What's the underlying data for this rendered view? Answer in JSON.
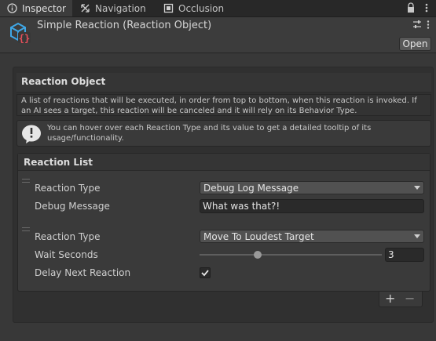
{
  "tabs": [
    {
      "label": "Inspector",
      "icon": "info-icon"
    },
    {
      "label": "Navigation",
      "icon": "navigation-icon"
    },
    {
      "label": "Occlusion",
      "icon": "occlusion-icon"
    }
  ],
  "header": {
    "title": "Simple Reaction (Reaction Object)",
    "open_label": "Open"
  },
  "reaction_object": {
    "title": "Reaction Object",
    "description": "A list of reactions that will be executed, in order from top to bottom, when this reaction is invoked. If an AI sees a target, this reaction will be canceled and it will rely on its Behavior Type.",
    "help": "You can hover over each Reaction Type and its value to get a detailed tooltip of its usage/functionality."
  },
  "reaction_list": {
    "title": "Reaction List",
    "items": [
      {
        "type_label": "Reaction Type",
        "type_value": "Debug Log Message",
        "field_label": "Debug Message",
        "field_value": "What was that?!"
      },
      {
        "type_label": "Reaction Type",
        "type_value": "Move To Loudest Target",
        "field_label": "Wait Seconds",
        "field_value": "3",
        "slider_fraction": 0.31,
        "delay_label": "Delay Next Reaction",
        "delay_checked": true
      }
    ],
    "add_label": "+",
    "remove_label": "−"
  }
}
